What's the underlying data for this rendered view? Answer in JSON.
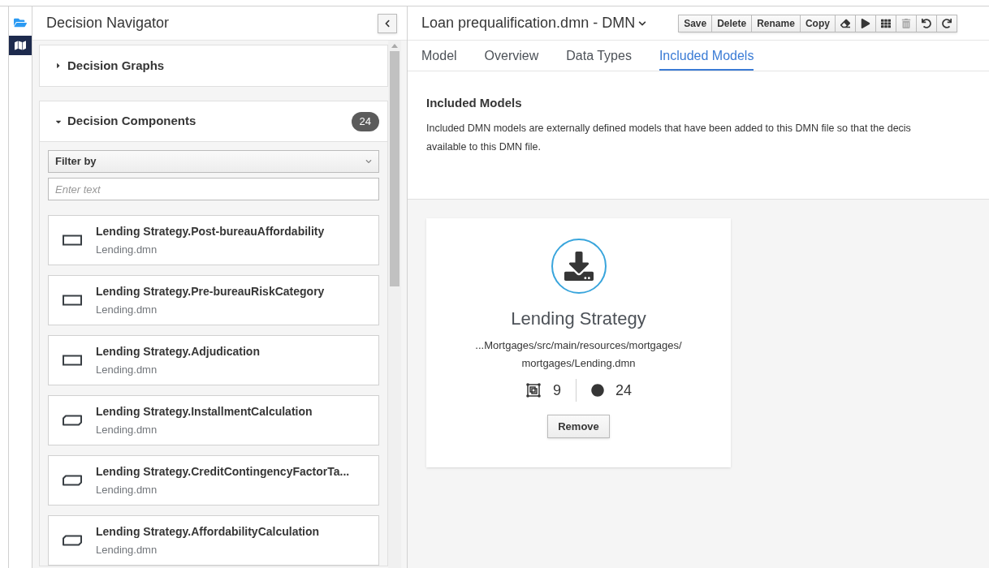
{
  "navigator": {
    "title": "Decision Navigator",
    "sections": [
      {
        "title": "Decision Graphs",
        "expanded": false
      },
      {
        "title": "Decision Components",
        "expanded": true,
        "count": "24"
      }
    ],
    "filter": {
      "label": "Filter by"
    },
    "search": {
      "placeholder": "Enter text"
    },
    "components": [
      {
        "kind": "decision",
        "title": "Lending Strategy.Post-bureauAffordability",
        "file": "Lending.dmn"
      },
      {
        "kind": "decision",
        "title": "Lending Strategy.Pre-bureauRiskCategory",
        "file": "Lending.dmn"
      },
      {
        "kind": "decision",
        "title": "Lending Strategy.Adjudication",
        "file": "Lending.dmn"
      },
      {
        "kind": "bkm",
        "title": "Lending Strategy.InstallmentCalculation",
        "file": "Lending.dmn"
      },
      {
        "kind": "bkm",
        "title": "Lending Strategy.CreditContingencyFactorTa...",
        "file": "Lending.dmn"
      },
      {
        "kind": "bkm",
        "title": "Lending Strategy.AffordabilityCalculation",
        "file": "Lending.dmn"
      }
    ]
  },
  "editor": {
    "title": "Loan prequalification.dmn - DMN",
    "toolbar": [
      {
        "kind": "text",
        "label": "Save",
        "disabled": false
      },
      {
        "kind": "text",
        "label": "Delete",
        "disabled": false
      },
      {
        "kind": "text",
        "label": "Rename",
        "disabled": false
      },
      {
        "kind": "text",
        "label": "Copy",
        "disabled": false
      },
      {
        "kind": "eraser",
        "disabled": false
      },
      {
        "kind": "play",
        "disabled": false
      },
      {
        "kind": "grid",
        "disabled": false
      },
      {
        "kind": "trash",
        "disabled": true
      },
      {
        "kind": "undo",
        "disabled": false
      },
      {
        "kind": "redo",
        "disabled": false
      }
    ],
    "tabs": [
      {
        "label": "Model",
        "selected": false
      },
      {
        "label": "Overview",
        "selected": false
      },
      {
        "label": "Data Types",
        "selected": false
      },
      {
        "label": "Included Models",
        "selected": true
      }
    ],
    "heading": "Included Models",
    "description_lines": [
      "Included DMN models are externally defined models that have been added to this DMN file so that the decis",
      "available to this DMN file."
    ],
    "model_card": {
      "name": "Lending Strategy",
      "path_lines": [
        "...Mortgages/src/main/resources/mortgages/",
        "mortgages/Lending.dmn"
      ],
      "drg_elements": "9",
      "data_types": "24",
      "button": "Remove"
    }
  }
}
